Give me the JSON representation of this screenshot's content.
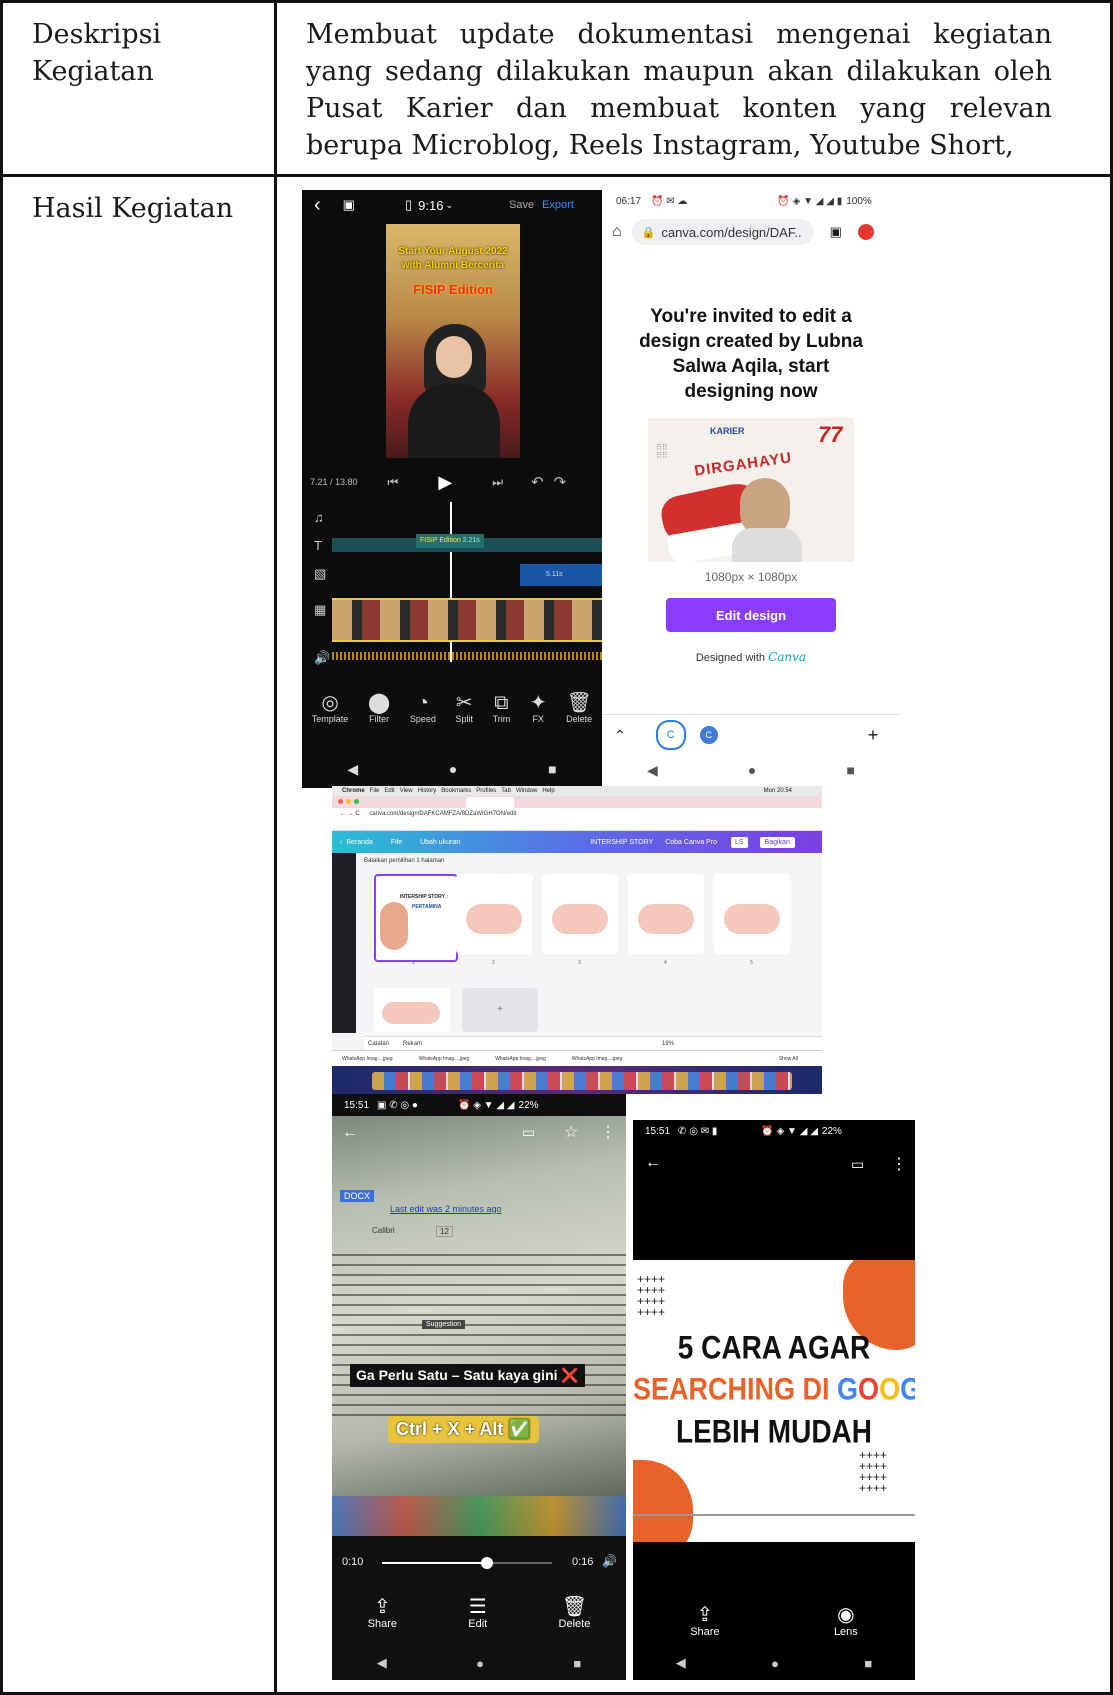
{
  "description": {
    "label": "Deskripsi Kegiatan",
    "text": "Membuat update dokumentasi mengenai kegiatan yang sedang dilakukan maupun akan dilakukan oleh Pusat Karier dan membuat konten yang relevan berupa  Microblog, Reels Instagram, Youtube Short,"
  },
  "result": {
    "label": "Hasil Kegiatan"
  },
  "editor_shot": {
    "aspect": "9:16",
    "save": "Save",
    "export": "Export",
    "video_line1": "Start Your August 2022",
    "video_line2": "with Alumni Bercerita",
    "video_line3": "FISIP Edition",
    "time": "7.21 / 13.80",
    "text_clip": "FISIP Edition",
    "text_clip_len": "2.21s",
    "sticker_len": "5.11s",
    "tools": [
      {
        "icon": "◎",
        "label": "Template"
      },
      {
        "icon": "⬤",
        "label": "Filter"
      },
      {
        "icon": "◔",
        "label": "Speed"
      },
      {
        "icon": "✂",
        "label": "Split"
      },
      {
        "icon": "⧉",
        "label": "Trim"
      },
      {
        "icon": "✦",
        "label": "FX"
      },
      {
        "icon": "🗑",
        "label": "Delete"
      }
    ]
  },
  "canva_shot": {
    "time": "06:17",
    "battery": "100%",
    "url": "canva.com/design/DAF..",
    "invite": "You're invited to edit a design created by Lubna Salwa Aqila, start designing now",
    "thumb_title": "DIRGAHAYU",
    "thumb_brand": "KARIER",
    "thumb_num": "77",
    "size": "1080px × 1080px",
    "button": "Edit design",
    "designed_with": "Designed with",
    "canva_logo": "Canva"
  },
  "desktop_shot": {
    "menu": [
      "Chrome",
      "File",
      "Edit",
      "View",
      "History",
      "Bookmarks",
      "Profiles",
      "Tab",
      "Window",
      "Help"
    ],
    "clock": "Mon 20.54",
    "url": "canva.com/design/DAFKCAMFZA/8DZaWIGH7ON/edit",
    "toolbar_left": [
      "Beranda",
      "File",
      "Ubah ukuran"
    ],
    "project": "INTERSHIP STORY",
    "try_pro": "Coba Canva Pro",
    "share": "Bagikan",
    "panel_title": "Batalkan pemilihan 1 halaman",
    "pages": [
      "1",
      "2",
      "3",
      "4",
      "5"
    ],
    "page1_title": "INTERSHIP STORY :",
    "page1_brand": "PERTAMINA",
    "notes": "Catatan",
    "record": "Rekam",
    "zoom": "19%",
    "downloads": [
      "WhatsApp Imag....jpeg",
      "WhatsApp Imag....jpeg",
      "WhatsApp Imag....jpeg",
      "WhatsApp Imag....jpeg"
    ],
    "show_all": "Show All"
  },
  "video_shot": {
    "time": "15:51",
    "battery": "22%",
    "doc_badge": "DOCX",
    "last_edit": "Last edit was 2 minutes ago",
    "font": "Calibri",
    "font_size": "12",
    "suggestion": "Suggestion",
    "caption1": "Ga Perlu Satu – Satu kaya gini ❌",
    "caption2": "Ctrl + X + Alt ✅",
    "elapsed": "0:10",
    "duration": "0:16",
    "progress": 0.62,
    "actions": [
      {
        "icon": "⇪",
        "label": "Share"
      },
      {
        "icon": "☰",
        "label": "Edit"
      },
      {
        "icon": "🗑",
        "label": "Delete"
      }
    ]
  },
  "image_shot": {
    "time": "15:51",
    "battery": "22%",
    "line1": "5 CARA AGAR",
    "line2a": "SEARCHING DI ",
    "google": [
      "G",
      "O",
      "O",
      "G",
      "L",
      "E"
    ],
    "google_colors": [
      "#4285f4",
      "#ea4335",
      "#fbbc05",
      "#4285f4",
      "#34a853",
      "#ea4335"
    ],
    "line3": "LEBIH MUDAH",
    "actions": [
      {
        "icon": "⇪",
        "label": "Share"
      },
      {
        "icon": "◉",
        "label": "Lens"
      }
    ]
  },
  "colors": {
    "canva_purple": "#8b3dff",
    "orange": "#e8622a"
  }
}
